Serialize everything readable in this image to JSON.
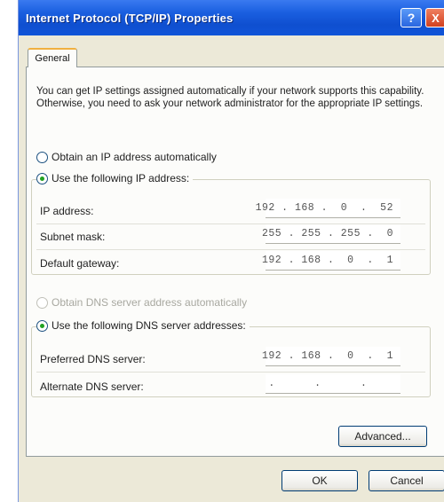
{
  "window": {
    "title": "Internet Protocol (TCP/IP) Properties",
    "help_label": "?",
    "close_label": "X"
  },
  "tabs": [
    {
      "label": "General",
      "selected": true
    }
  ],
  "intro_text": "You can get IP settings assigned automatically if your network supports this capability. Otherwise, you need to ask your network administrator for the appropriate IP settings.",
  "ip_section": {
    "auto_label": "Obtain an IP address automatically",
    "manual_label": "Use the following IP address:",
    "selected": "manual",
    "fields": [
      {
        "label": "IP address:",
        "value": "192 . 168 .  0  .  52"
      },
      {
        "label": "Subnet mask:",
        "value": "255 . 255 . 255 .  0"
      },
      {
        "label": "Default gateway:",
        "value": "192 . 168 .  0  .  1"
      }
    ]
  },
  "dns_section": {
    "auto_label": "Obtain DNS server address automatically",
    "manual_label": "Use the following DNS server addresses:",
    "selected": "manual",
    "auto_enabled": false,
    "fields": [
      {
        "label": "Preferred DNS server:",
        "value": "192 . 168 .  0  .  1"
      },
      {
        "label": "Alternate DNS server:",
        "value": "    .      .      .    "
      }
    ]
  },
  "buttons": {
    "advanced": "Advanced...",
    "ok": "OK",
    "cancel": "Cancel"
  },
  "colors": {
    "title_bar": "#1a5fe0",
    "dialog_bg": "#ece9d8",
    "panel_bg": "#fcfcfa",
    "radio_dot": "#21a121",
    "tab_highlight": "#f0b040"
  }
}
